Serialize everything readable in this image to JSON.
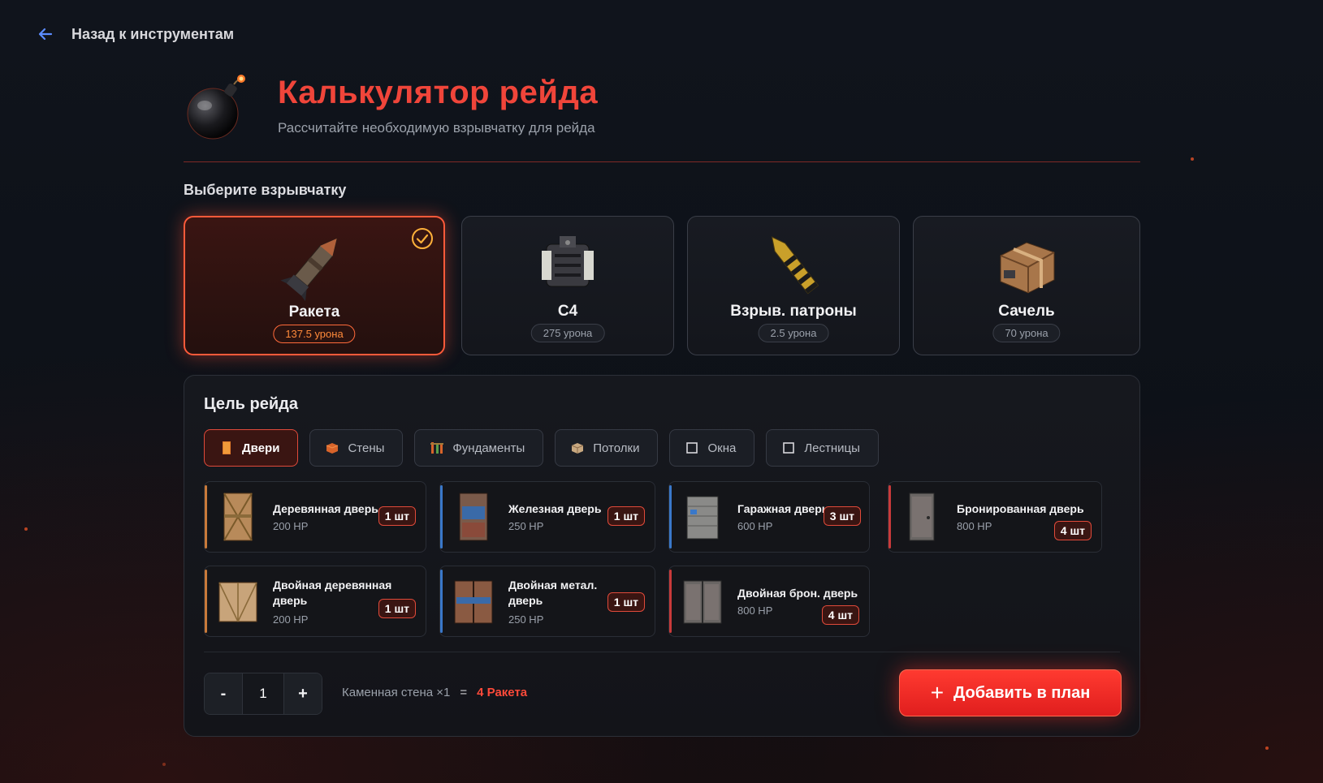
{
  "nav": {
    "back_label": "Назад к инструментам"
  },
  "header": {
    "title": "Калькулятор рейда",
    "subtitle": "Рассчитайте необходимую взрывчатку для рейда"
  },
  "explosives_label": "Выберите взрывчатку",
  "explosives": [
    {
      "name": "Ракета",
      "damage": "137.5 урона",
      "selected": true,
      "icon": "rocket-icon"
    },
    {
      "name": "C4",
      "damage": "275 урона",
      "selected": false,
      "icon": "c4-icon"
    },
    {
      "name": "Взрыв. патроны",
      "damage": "2.5 урона",
      "selected": false,
      "icon": "explosive-ammo-icon"
    },
    {
      "name": "Сачель",
      "damage": "70 урона",
      "selected": false,
      "icon": "satchel-icon"
    }
  ],
  "target": {
    "title": "Цель рейда",
    "tabs": [
      {
        "label": "Двери",
        "active": true,
        "icon": "door-icon"
      },
      {
        "label": "Стены",
        "active": false,
        "icon": "wall-icon"
      },
      {
        "label": "Фундаменты",
        "active": false,
        "icon": "foundation-icon"
      },
      {
        "label": "Потолки",
        "active": false,
        "icon": "ceiling-icon"
      },
      {
        "label": "Окна",
        "active": false,
        "icon": "window-icon"
      },
      {
        "label": "Лестницы",
        "active": false,
        "icon": "stairs-icon"
      }
    ],
    "items": [
      {
        "name": "Деревянная дверь",
        "hp": "200 HP",
        "count": "1 шт",
        "tier": "wood"
      },
      {
        "name": "Железная дверь",
        "hp": "250 HP",
        "count": "1 шт",
        "tier": "metal"
      },
      {
        "name": "Гаражная дверь",
        "hp": "600 HP",
        "count": "3 шт",
        "tier": "metal"
      },
      {
        "name": "Бронированная дверь",
        "hp": "800 HP",
        "count": "4 шт",
        "tier": "armored"
      },
      {
        "name": "Двойная деревянная дверь",
        "hp": "200 HP",
        "count": "1 шт",
        "tier": "wood"
      },
      {
        "name": "Двойная метал. дверь",
        "hp": "250 HP",
        "count": "1 шт",
        "tier": "metal"
      },
      {
        "name": "Двойная брон. дверь",
        "hp": "800 HP",
        "count": "4 шт",
        "tier": "armored"
      }
    ]
  },
  "calc": {
    "minus": "-",
    "quantity": "1",
    "plus": "+",
    "summary_target": "Каменная стена ×1",
    "summary_eq": "=",
    "summary_result": "4 Ракета"
  },
  "add_button": {
    "plus": "+",
    "label": "Добавить в план"
  },
  "colors": {
    "accent": "#f0453a",
    "wood": "#c97a3a",
    "metal": "#3a78c9",
    "armored": "#c93a3a"
  }
}
